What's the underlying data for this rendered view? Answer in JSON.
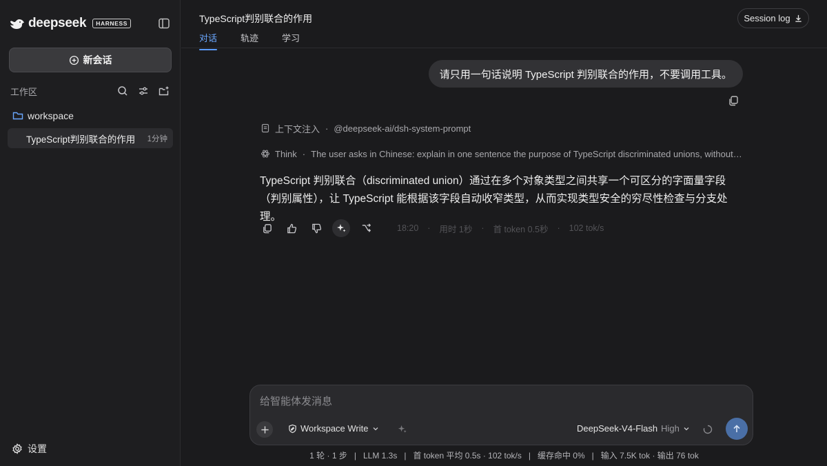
{
  "app": {
    "brand": "deepseek",
    "badge": "HARNESS"
  },
  "sidebar": {
    "new_chat_label": "新会话",
    "workspace_title": "工作区",
    "folder_name": "workspace",
    "session": {
      "title": "TypeScript判别联合的作用",
      "time": "1分钟"
    },
    "settings_label": "设置"
  },
  "header": {
    "title": "TypeScript判别联合的作用",
    "tabs": [
      "对话",
      "轨迹",
      "学习"
    ],
    "session_log_label": "Session log"
  },
  "conversation": {
    "user_message": "请只用一句话说明 TypeScript 判别联合的作用，不要调用工具。",
    "context": {
      "label": "上下文注入",
      "value": "@deepseek-ai/dsh-system-prompt"
    },
    "think": {
      "label": "Think",
      "text": "The user asks in Chinese: explain in one sentence the purpose of TypeScript discriminated unions, without calling tools."
    },
    "answer": "TypeScript 判别联合（discriminated union）通过在多个对象类型之间共享一个可区分的字面量字段（判别属性），让 TypeScript 能根据该字段自动收窄类型，从而实现类型安全的穷尽性检查与分支处理。",
    "meta": {
      "time": "18:20",
      "duration": "用时 1秒",
      "first_token": "首 token 0.5秒",
      "speed": "102 tok/s"
    }
  },
  "composer": {
    "placeholder": "给智能体发消息",
    "mode_label": "Workspace Write",
    "model_name": "DeepSeek-V4-Flash",
    "model_level": "High"
  },
  "status_bar": "1 轮 · 1 步   |   LLM 1.3s   |   首 token 平均 0.5s · 102 tok/s   |   缓存命中 0%   |   输入 7.5K tok · 输出 76 tok",
  "colors": {
    "accent": "#5b9bff",
    "send_button": "#4a6fa6",
    "background": "#1b1b1d"
  }
}
